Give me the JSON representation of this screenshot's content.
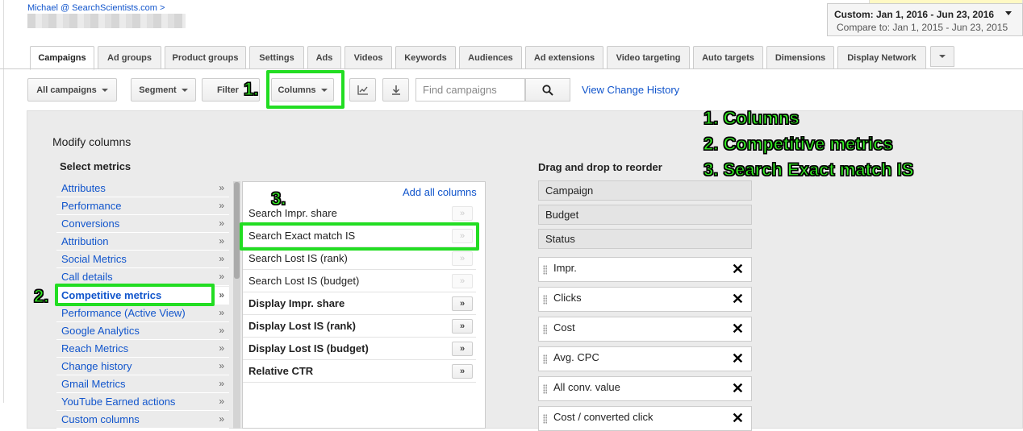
{
  "account": {
    "line": "Michael @ SearchScientists.com >"
  },
  "date": {
    "range": "Custom: Jan 1, 2016 - Jun 23, 2016",
    "compare": "Compare to: Jan 1, 2015 - Jun 23, 2015"
  },
  "tabs": [
    {
      "label": "Campaigns"
    },
    {
      "label": "Ad groups"
    },
    {
      "label": "Product groups"
    },
    {
      "label": "Settings"
    },
    {
      "label": "Ads"
    },
    {
      "label": "Videos"
    },
    {
      "label": "Keywords"
    },
    {
      "label": "Audiences"
    },
    {
      "label": "Ad extensions"
    },
    {
      "label": "Video targeting"
    },
    {
      "label": "Auto targets"
    },
    {
      "label": "Dimensions"
    },
    {
      "label": "Display Network"
    }
  ],
  "toolbar": {
    "all_campaigns": "All campaigns",
    "segment": "Segment",
    "filter": "Filter",
    "columns": "Columns",
    "search_placeholder": "Find campaigns",
    "view_history": "View Change History"
  },
  "panel": {
    "title": "Modify columns",
    "select_metrics": "Select metrics",
    "add_all": "Add all columns",
    "drag_title": "Drag and drop to reorder",
    "categories": [
      {
        "label": "Attributes"
      },
      {
        "label": "Performance"
      },
      {
        "label": "Conversions"
      },
      {
        "label": "Attribution"
      },
      {
        "label": "Social Metrics"
      },
      {
        "label": "Call details"
      },
      {
        "label": "Competitive metrics"
      },
      {
        "label": "Performance (Active View)"
      },
      {
        "label": "Google Analytics"
      },
      {
        "label": "Reach Metrics"
      },
      {
        "label": "Change history"
      },
      {
        "label": "Gmail Metrics"
      },
      {
        "label": "YouTube Earned actions"
      },
      {
        "label": "Custom columns"
      }
    ],
    "arrow": "»",
    "metrics": [
      {
        "label": "Search Impr. share"
      },
      {
        "label": "Search Exact match IS"
      },
      {
        "label": "Search Lost IS (rank)"
      },
      {
        "label": "Search Lost IS (budget)"
      },
      {
        "label": "Display Impr. share"
      },
      {
        "label": "Display Lost IS (rank)"
      },
      {
        "label": "Display Lost IS (budget)"
      },
      {
        "label": "Relative CTR"
      }
    ],
    "fixed_columns": [
      {
        "label": "Campaign"
      },
      {
        "label": "Budget"
      },
      {
        "label": "Status"
      }
    ],
    "columns": [
      {
        "label": "Impr."
      },
      {
        "label": "Clicks"
      },
      {
        "label": "Cost"
      },
      {
        "label": "Avg. CPC"
      },
      {
        "label": "All conv. value"
      },
      {
        "label": "Cost / converted click"
      }
    ],
    "remove_glyph": "✕"
  },
  "annotations": {
    "step1": "1.",
    "step2": "2.",
    "step3": "3.",
    "legend": [
      "1. Columns",
      "2. Competitive metrics",
      "3. Search Exact match IS"
    ]
  },
  "colors": {
    "highlight": "#22dd22",
    "link": "#1155cc"
  }
}
